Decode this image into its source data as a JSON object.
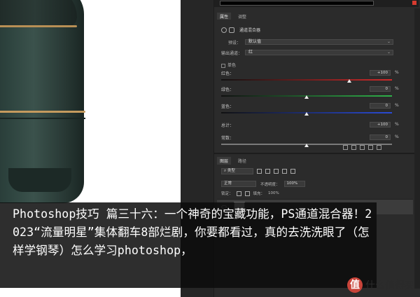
{
  "caption": {
    "text": "Photoshop技巧 篇三十六：一个神奇的宝藏功能，PS通道混合器！2023“流量明星”集体翻车8部烂剧，你要都看过，真的去洗洗眼了（怎样学钢琴）怎么学习photoshop，"
  },
  "watermark": {
    "logo": "值",
    "text": "什么值得买"
  },
  "properties_panel": {
    "tabs": [
      "属性",
      "调整"
    ],
    "title": "通道混合器",
    "preset_label": "预设：",
    "preset_value": "默认值",
    "output_label": "输出通道：",
    "output_value": "红",
    "mono_label": "单色",
    "channels": [
      {
        "label": "红色：",
        "value": "+100",
        "unit": "%",
        "level": 100,
        "color": "#d02a2a"
      },
      {
        "label": "绿色：",
        "value": "0",
        "unit": "%",
        "level": 0,
        "color": "#2fb24a"
      },
      {
        "label": "蓝色：",
        "value": "0",
        "unit": "%",
        "level": 0,
        "color": "#2a4bd6"
      },
      {
        "label": "总计：",
        "value": "+100",
        "unit": "%",
        "level": null,
        "color": "#8a8a8a"
      },
      {
        "label": "常数：",
        "value": "0",
        "unit": "%",
        "level": 0,
        "color": "#8a8a8a"
      }
    ]
  },
  "layers_panel": {
    "tabs": [
      "图层",
      "路径"
    ],
    "kind_value": "类型",
    "blend_value": "正常",
    "opacity_label": "不透明度：",
    "opacity_value": "100%",
    "lock_label": "锁定：",
    "fill_label": "填充：",
    "fill_value": "100%"
  },
  "icons": [
    "chevron-down-icon",
    "eye-icon",
    "lock-icon",
    "layer-thumbnail-icon"
  ],
  "colors": {
    "panel_bg": "#2b2b2b",
    "caption_bg": "#0c0c0c",
    "fryer_green": "#2f4540",
    "gold_trim": "#b88f55",
    "watermark_red": "#c9443a"
  }
}
